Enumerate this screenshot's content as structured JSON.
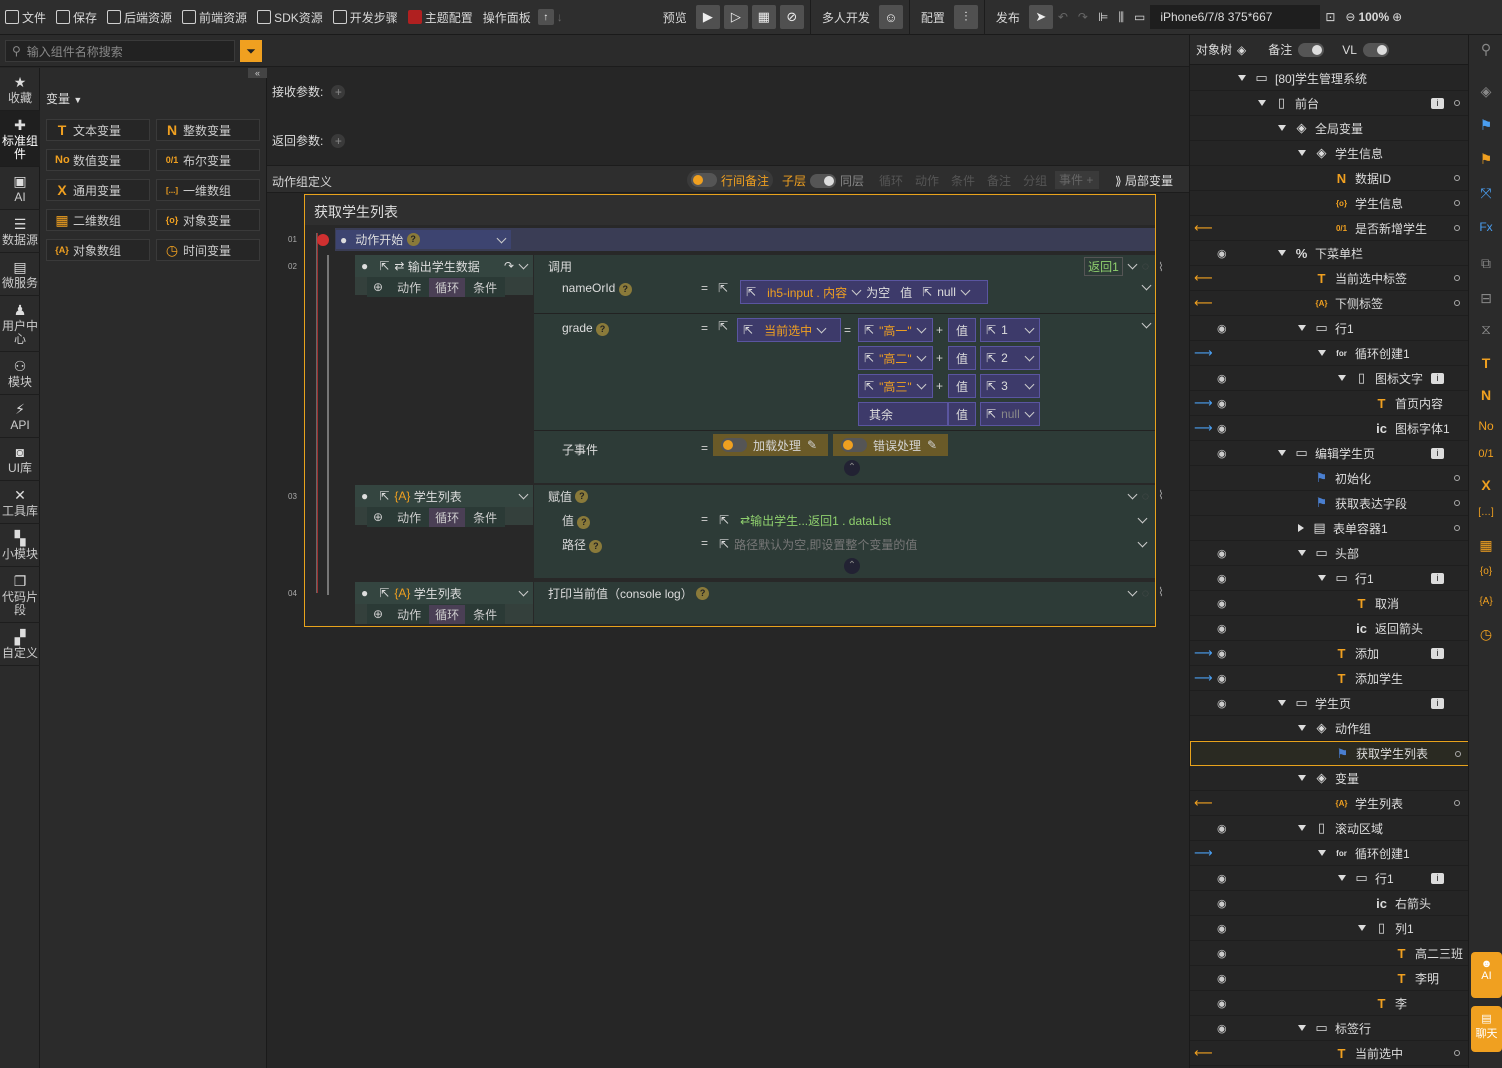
{
  "toolbar": {
    "items": [
      "文件",
      "保存",
      "后端资源",
      "前端资源",
      "SDK资源",
      "开发步骤",
      "主题配置",
      "操作面板"
    ],
    "preview": "预览",
    "multi_dev": "多人开发",
    "config": "配置",
    "publish": "发布",
    "device": "iPhone6/7/8 375*667",
    "zoom": "100%"
  },
  "search": {
    "placeholder": "输入组件名称搜索"
  },
  "left_rail": [
    "收藏",
    "标准组件",
    "AI",
    "数据源",
    "微服务",
    "用户中心",
    "模块",
    "API",
    "UI库",
    "工具库",
    "小模块",
    "代码片段",
    "自定义"
  ],
  "comp_panel": {
    "title": "变量",
    "chips": [
      {
        "icon": "T",
        "label": "文本变量"
      },
      {
        "icon": "N",
        "label": "整数变量"
      },
      {
        "icon": "No",
        "label": "数值变量"
      },
      {
        "icon": "0/1",
        "label": "布尔变量"
      },
      {
        "icon": "X",
        "label": "通用变量"
      },
      {
        "icon": "[...]",
        "label": "一维数组"
      },
      {
        "icon": "▦",
        "label": "二维数组"
      },
      {
        "icon": "{o}",
        "label": "对象变量"
      },
      {
        "icon": "{A}",
        "label": "对象数组"
      },
      {
        "icon": "◷",
        "label": "时间变量"
      }
    ]
  },
  "canvas": {
    "recv_params": "接收参数:",
    "return_params": "返回参数:",
    "group_def": "动作组定义",
    "row_note": "行间备注",
    "sub_layer": "子层",
    "same_layer": "同层",
    "filters": [
      "循环",
      "动作",
      "条件",
      "备注",
      "分组"
    ],
    "event": "事件",
    "local_var": "局部变量",
    "flow_title": "获取学生列表",
    "start": "动作开始",
    "line_nums": [
      "01",
      "02",
      "03",
      "04"
    ],
    "step2": {
      "name": "输出学生数据",
      "call": "调用",
      "return_tag": "返回1",
      "p1_name": "nameOrId",
      "p1_src": "ih5-input . 内容",
      "p1_empty": "为空",
      "p1_val": "值",
      "p1_null": "null",
      "p2_name": "grade",
      "p2_cur": "当前选中",
      "cases": [
        {
          "k": "\"高一\"",
          "v": "1"
        },
        {
          "k": "\"高二\"",
          "v": "2"
        },
        {
          "k": "\"高三\"",
          "v": "3"
        }
      ],
      "else": "其余",
      "else_val": "null",
      "val_label": "值",
      "sub_event": "子事件",
      "loading": "加载处理",
      "error": "错误处理"
    },
    "step3": {
      "name": "学生列表",
      "assign": "赋值",
      "val": "值",
      "val_src": "输出学生...返回1 . dataList",
      "path": "路径",
      "path_ph": "路径默认为空,即设置整个变量的值"
    },
    "step4": {
      "name": "学生列表",
      "print": "打印当前值（console log）"
    },
    "action_tabs": [
      "动作",
      "循环",
      "条件"
    ]
  },
  "tree": {
    "tab": "对象树",
    "note": "备注",
    "vl": "VL",
    "nodes": [
      {
        "label": "[80]学生管理系统",
        "indent": 0,
        "icon": "▭"
      },
      {
        "label": "前台",
        "indent": 1,
        "icon": "▯",
        "info": true,
        "dot": true
      },
      {
        "label": "全局变量",
        "indent": 2,
        "icon": "◈"
      },
      {
        "label": "学生信息",
        "indent": 3,
        "icon": "◈"
      },
      {
        "label": "数据ID",
        "indent": 4,
        "icon": "N",
        "dot": true
      },
      {
        "label": "学生信息",
        "indent": 4,
        "icon": "{o}",
        "dot": true
      },
      {
        "label": "是否新增学生",
        "indent": 4,
        "icon": "0/1",
        "dot": true,
        "arrow": "o"
      },
      {
        "label": "下菜单栏",
        "indent": 2,
        "icon": "%",
        "eye": true
      },
      {
        "label": "当前选中标签",
        "indent": 3,
        "icon": "T",
        "dot": true,
        "arrow": "o"
      },
      {
        "label": "下侧标签",
        "indent": 3,
        "icon": "{A}",
        "dot": true,
        "arrow": "o"
      },
      {
        "label": "行1",
        "indent": 3,
        "icon": "▭",
        "eye": true
      },
      {
        "label": "循环创建1",
        "indent": 4,
        "icon": "for",
        "arrow": "b"
      },
      {
        "label": "图标文字",
        "indent": 5,
        "icon": "▯",
        "eye": true,
        "info": true
      },
      {
        "label": "首页内容",
        "indent": 6,
        "icon": "T",
        "eye": true,
        "arrow": "b"
      },
      {
        "label": "图标字体1",
        "indent": 6,
        "icon": "ic",
        "eye": true,
        "arrow": "b"
      },
      {
        "label": "编辑学生页",
        "indent": 2,
        "icon": "▭",
        "eye": true,
        "info": true
      },
      {
        "label": "初始化",
        "indent": 3,
        "icon": "⚑",
        "dot": true
      },
      {
        "label": "获取表达字段",
        "indent": 3,
        "icon": "⚑",
        "dot": true
      },
      {
        "label": "表单容器1",
        "indent": 3,
        "icon": "▤",
        "dot": true
      },
      {
        "label": "头部",
        "indent": 3,
        "icon": "▭",
        "eye": true
      },
      {
        "label": "行1",
        "indent": 4,
        "icon": "▭",
        "eye": true,
        "info": true
      },
      {
        "label": "取消",
        "indent": 5,
        "icon": "T",
        "eye": true
      },
      {
        "label": "返回箭头",
        "indent": 5,
        "icon": "ic",
        "eye": true
      },
      {
        "label": "添加",
        "indent": 4,
        "icon": "T",
        "eye": true,
        "arrow": "b",
        "info": true
      },
      {
        "label": "添加学生",
        "indent": 4,
        "icon": "T",
        "eye": true,
        "arrow": "b"
      },
      {
        "label": "学生页",
        "indent": 2,
        "icon": "▭",
        "eye": true,
        "info": true
      },
      {
        "label": "动作组",
        "indent": 3,
        "icon": "◈"
      },
      {
        "label": "获取学生列表",
        "indent": 4,
        "icon": "⚑",
        "dot": true,
        "sel": true
      },
      {
        "label": "变量",
        "indent": 3,
        "icon": "◈"
      },
      {
        "label": "学生列表",
        "indent": 4,
        "icon": "{A}",
        "dot": true,
        "arrow": "o"
      },
      {
        "label": "滚动区域",
        "indent": 3,
        "icon": "▯",
        "eye": true
      },
      {
        "label": "循环创建1",
        "indent": 4,
        "icon": "for",
        "arrow": "b"
      },
      {
        "label": "行1",
        "indent": 5,
        "icon": "▭",
        "eye": true,
        "info": true
      },
      {
        "label": "右箭头",
        "indent": 6,
        "icon": "ic",
        "eye": true
      },
      {
        "label": "列1",
        "indent": 6,
        "icon": "▯",
        "eye": true
      },
      {
        "label": "高二三班",
        "indent": 7,
        "icon": "T",
        "eye": true
      },
      {
        "label": "李明",
        "indent": 7,
        "icon": "T",
        "eye": true
      },
      {
        "label": "李",
        "indent": 6,
        "icon": "T",
        "eye": true
      },
      {
        "label": "标签行",
        "indent": 3,
        "icon": "▭",
        "eye": true
      },
      {
        "label": "当前选中",
        "indent": 4,
        "icon": "T",
        "dot": true,
        "arrow": "o"
      }
    ]
  },
  "right_rail": {
    "ai": "AI",
    "chat": "聊天"
  }
}
